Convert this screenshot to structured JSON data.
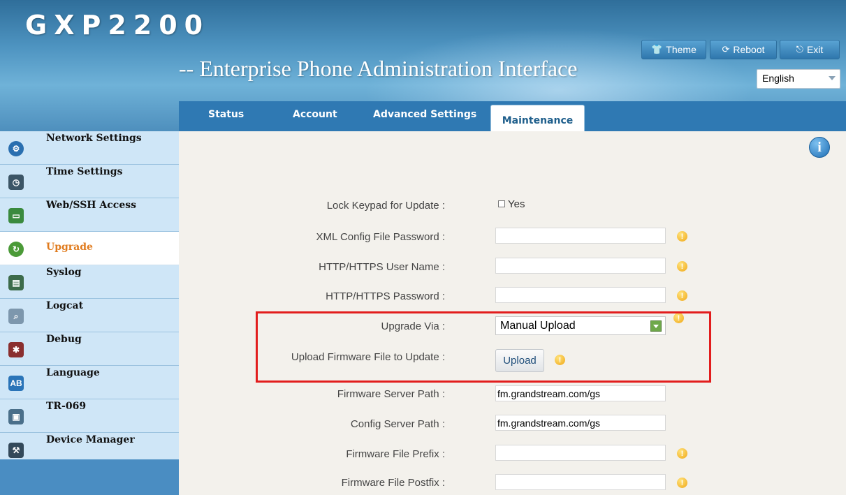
{
  "header": {
    "product": "GXP2200",
    "subtitle": "-- Enterprise Phone Administration Interface",
    "buttons": {
      "theme": "Theme",
      "reboot": "Reboot",
      "exit": "Exit"
    },
    "language_selected": "English"
  },
  "tabs": {
    "status": "Status",
    "account": "Account",
    "advanced": "Advanced Settings",
    "maintenance": "Maintenance"
  },
  "sidebar": {
    "items": [
      {
        "label": "Network Settings",
        "icon": "network-icon"
      },
      {
        "label": "Time Settings",
        "icon": "clock-icon"
      },
      {
        "label": "Web/SSH Access",
        "icon": "monitor-icon"
      },
      {
        "label": "Upgrade",
        "icon": "upgrade-icon"
      },
      {
        "label": "Syslog",
        "icon": "syslog-icon"
      },
      {
        "label": "Logcat",
        "icon": "magnifier-icon"
      },
      {
        "label": "Debug",
        "icon": "bug-icon"
      },
      {
        "label": "Language",
        "icon": "language-icon"
      },
      {
        "label": "TR-069",
        "icon": "server-icon"
      },
      {
        "label": "Device Manager",
        "icon": "device-manager-icon"
      }
    ]
  },
  "form": {
    "lock_keypad": {
      "label": "Lock Keypad for Update :",
      "option": "Yes"
    },
    "xml_password": {
      "label": "XML Config File Password :",
      "value": ""
    },
    "http_user": {
      "label": "HTTP/HTTPS User Name :",
      "value": ""
    },
    "http_password": {
      "label": "HTTP/HTTPS Password :",
      "value": ""
    },
    "upgrade_via": {
      "label": "Upgrade Via :",
      "value": "Manual Upload"
    },
    "upload_firmware": {
      "label": "Upload Firmware File to Update :",
      "button": "Upload"
    },
    "firmware_path": {
      "label": "Firmware Server Path :",
      "value": "fm.grandstream.com/gs"
    },
    "config_path": {
      "label": "Config Server Path :",
      "value": "fm.grandstream.com/gs"
    },
    "fw_prefix": {
      "label": "Firmware File Prefix :",
      "value": ""
    },
    "fw_postfix": {
      "label": "Firmware File Postfix :",
      "value": ""
    }
  },
  "colors": {
    "accent_active": "#e07b1e",
    "highlight_box": "#e21d1d",
    "tab_bar": "#2f79b3"
  }
}
